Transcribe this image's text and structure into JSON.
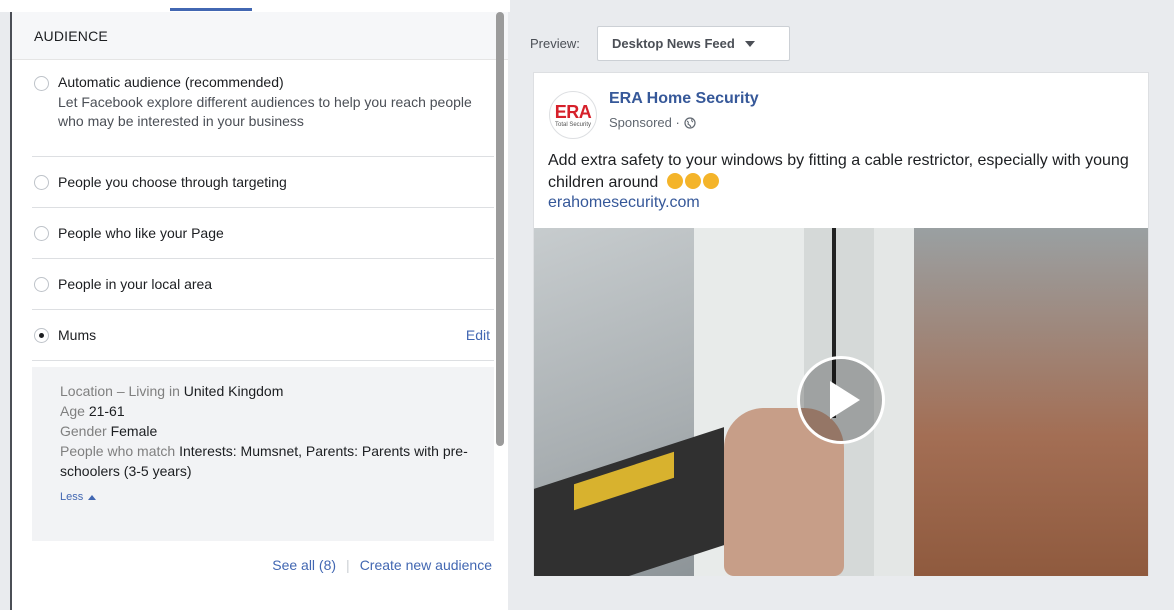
{
  "audience": {
    "header": "AUDIENCE",
    "options": [
      {
        "label": "Automatic audience (recommended)",
        "description": "Let Facebook explore different audiences to help you reach people who may be interested in your business",
        "selected": false
      },
      {
        "label": "People you choose through targeting",
        "selected": false
      },
      {
        "label": "People who like your Page",
        "selected": false
      },
      {
        "label": "People in your local area",
        "selected": false
      },
      {
        "label": "Mums",
        "selected": true,
        "action": "Edit"
      }
    ],
    "details": {
      "location_key": "Location – Living in",
      "location_value": "United Kingdom",
      "age_key": "Age",
      "age_value": "21-61",
      "gender_key": "Gender",
      "gender_value": "Female",
      "interests_key": "People who match",
      "interests_value": "Interests: Mumsnet, Parents: Parents with pre-schoolers (3-5 years)",
      "less_label": "Less"
    },
    "footer": {
      "see_all": "See all (8)",
      "create_new": "Create new audience"
    }
  },
  "preview": {
    "label": "Preview:",
    "placement": "Desktop News Feed"
  },
  "post": {
    "logo_text": "ERA",
    "logo_subtext": "Total Security",
    "page_name": "ERA Home Security",
    "sponsored": "Sponsored ·",
    "text": "Add extra safety to your windows by fitting a cable restrictor, especially with young children around",
    "link": "erahomesecurity.com"
  },
  "colors": {
    "link": "#4267b2",
    "page_name": "#365899",
    "logo_red": "#d6202a",
    "background": "#e9ebee"
  }
}
